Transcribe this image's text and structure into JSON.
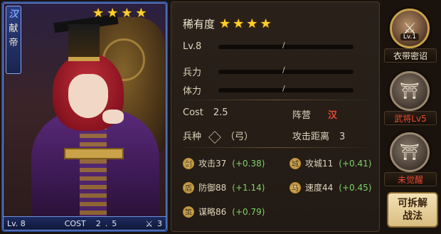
{
  "hero": {
    "faction_glyph": "汉",
    "name_chars": [
      "献",
      "帝"
    ],
    "stars": [
      "★",
      "★",
      "★",
      "★"
    ],
    "footer": {
      "level": "Lv. 8",
      "cost_label": "COST",
      "cost_value": "2.5",
      "icon": "⚔",
      "number": "3"
    }
  },
  "panel": {
    "rarity_label": "稀有度",
    "rarity_stars": [
      "★",
      "★",
      "★",
      "★"
    ],
    "bars": [
      {
        "label": "Lv.8",
        "slash": "/"
      },
      {
        "label": "兵力",
        "slash": "/"
      },
      {
        "label": "体力",
        "slash": "/"
      }
    ],
    "cost_label": "Cost",
    "cost_value": "2.5",
    "camp_label": "阵营",
    "camp_value": "汉",
    "unit_label": "兵种",
    "unit_value": "（弓）",
    "range_label": "攻击距离",
    "range_value": "3",
    "attributes": [
      {
        "label": "攻击",
        "value": "37",
        "bonus": "(+0.38)",
        "icon": "剑"
      },
      {
        "label": "攻城",
        "value": "11",
        "bonus": "(+0.41)",
        "icon": "城"
      },
      {
        "label": "防御",
        "value": "88",
        "bonus": "(+1.14)",
        "icon": "盾"
      },
      {
        "label": "速度",
        "value": "44",
        "bonus": "(+0.45)",
        "icon": "马"
      },
      {
        "label": "谋略",
        "value": "86",
        "bonus": "(+0.79)",
        "icon": "策"
      }
    ]
  },
  "side": {
    "skill1": {
      "lv": "Lv.1",
      "label": "衣带密诏"
    },
    "skill2": {
      "label": "武将Lv5"
    },
    "skill3": {
      "label": "未觉醒"
    },
    "action": {
      "line1": "可拆解",
      "line2": "战法"
    }
  },
  "colors": {
    "accent_red": "#e84a30",
    "bonus_green": "#7ed46a",
    "star_gold": "#ffd02a",
    "card_border": "#2f4f9a"
  }
}
